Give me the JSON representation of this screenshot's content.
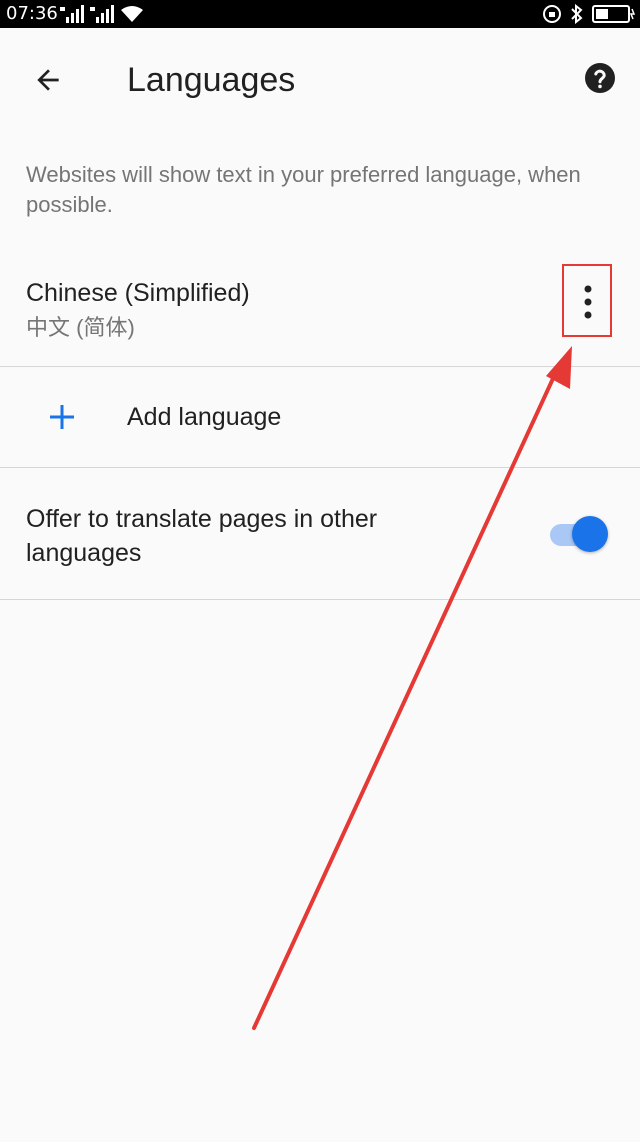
{
  "status_bar": {
    "time": "07:36"
  },
  "app_bar": {
    "title": "Languages",
    "back_icon": "arrow-back-icon",
    "help_icon": "help-circle-icon"
  },
  "description": "Websites will show text in your preferred language, when possible.",
  "languages": [
    {
      "name": "Chinese (Simplified)",
      "native": "中文 (简体)",
      "menu_icon": "more-vert-icon"
    }
  ],
  "add_language": {
    "label": "Add language",
    "icon": "plus-icon"
  },
  "translate": {
    "label": "Offer to translate pages in other languages",
    "enabled": true
  },
  "colors": {
    "accent": "#1a73e8",
    "annotation": "#e53935"
  }
}
